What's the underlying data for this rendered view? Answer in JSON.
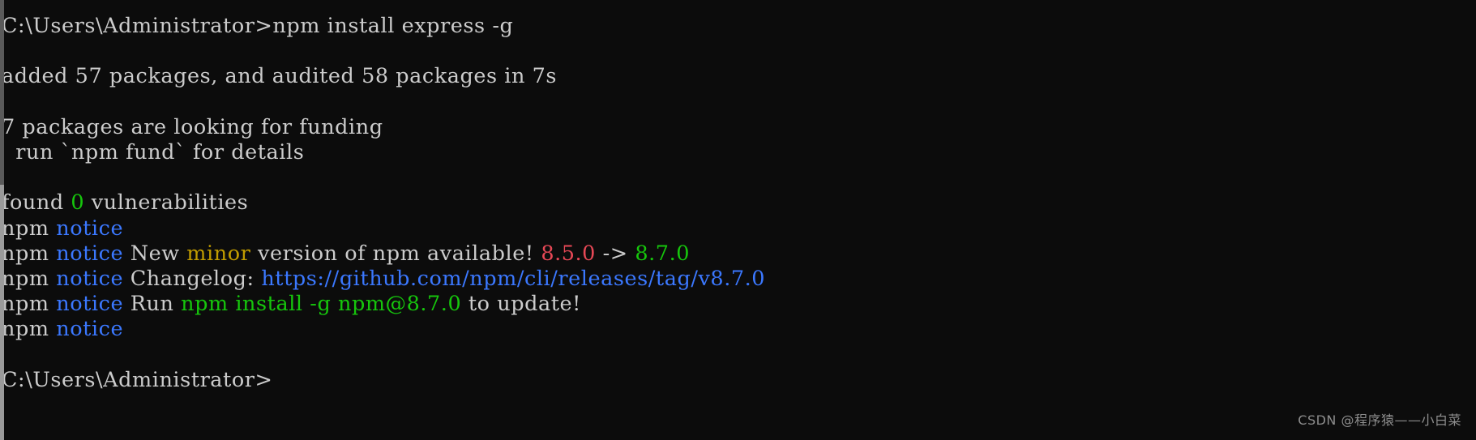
{
  "window": {
    "background_color": "#0c0c0c",
    "default_text_color": "#cccccc"
  },
  "scrollbar": {
    "track_color": "#9a9a9a",
    "thumb_color": "#5a5a5a"
  },
  "palette": {
    "white": "#cccccc",
    "green": "#16c60c",
    "blue": "#3b78ff",
    "yellow": "#c19c00",
    "red": "#e74856",
    "cyan": "#3b78ff"
  },
  "console": {
    "lines": [
      {
        "id": "line-command",
        "segments": [
          {
            "text": "C:\\Users\\Administrator>npm install express -g",
            "color": "white"
          }
        ]
      },
      {
        "id": "line-blank-1",
        "segments": [
          {
            "text": " ",
            "color": "white"
          }
        ]
      },
      {
        "id": "line-added-packages",
        "segments": [
          {
            "text": "added 57 packages, and audited 58 packages in 7s",
            "color": "white"
          }
        ]
      },
      {
        "id": "line-blank-2",
        "segments": [
          {
            "text": " ",
            "color": "white"
          }
        ]
      },
      {
        "id": "line-funding",
        "segments": [
          {
            "text": "7 packages are looking for funding",
            "color": "white"
          }
        ]
      },
      {
        "id": "line-fund-details",
        "segments": [
          {
            "text": "  run `npm fund` for details",
            "color": "white"
          }
        ]
      },
      {
        "id": "line-blank-3",
        "segments": [
          {
            "text": " ",
            "color": "white"
          }
        ]
      },
      {
        "id": "line-vulnerabilities",
        "segments": [
          {
            "text": "found ",
            "color": "white"
          },
          {
            "text": "0",
            "color": "green"
          },
          {
            "text": " vulnerabilities",
            "color": "white"
          }
        ]
      },
      {
        "id": "line-notice-1",
        "segments": [
          {
            "text": "npm ",
            "color": "white"
          },
          {
            "text": "notice",
            "color": "blue"
          }
        ]
      },
      {
        "id": "line-notice-new-version",
        "segments": [
          {
            "text": "npm ",
            "color": "white"
          },
          {
            "text": "notice",
            "color": "blue"
          },
          {
            "text": " New ",
            "color": "white"
          },
          {
            "text": "minor",
            "color": "yellow"
          },
          {
            "text": " version of npm available! ",
            "color": "white"
          },
          {
            "text": "8.5.0",
            "color": "red"
          },
          {
            "text": " -> ",
            "color": "white"
          },
          {
            "text": "8.7.0",
            "color": "green"
          }
        ]
      },
      {
        "id": "line-notice-changelog",
        "segments": [
          {
            "text": "npm ",
            "color": "white"
          },
          {
            "text": "notice",
            "color": "blue"
          },
          {
            "text": " Changelog: ",
            "color": "white"
          },
          {
            "text": "https://github.com/npm/cli/releases/tag/v8.7.0",
            "color": "cyan"
          }
        ]
      },
      {
        "id": "line-notice-run-update",
        "segments": [
          {
            "text": "npm ",
            "color": "white"
          },
          {
            "text": "notice",
            "color": "blue"
          },
          {
            "text": " Run ",
            "color": "white"
          },
          {
            "text": "npm install -g npm@8.7.0",
            "color": "green"
          },
          {
            "text": " to update!",
            "color": "white"
          }
        ]
      },
      {
        "id": "line-notice-2",
        "segments": [
          {
            "text": "npm ",
            "color": "white"
          },
          {
            "text": "notice",
            "color": "blue"
          }
        ]
      },
      {
        "id": "line-blank-4",
        "segments": [
          {
            "text": " ",
            "color": "white"
          }
        ]
      },
      {
        "id": "line-prompt",
        "segments": [
          {
            "text": "C:\\Users\\Administrator>",
            "color": "white"
          }
        ]
      }
    ]
  },
  "watermark": {
    "text": "CSDN @程序猿——小白菜"
  }
}
